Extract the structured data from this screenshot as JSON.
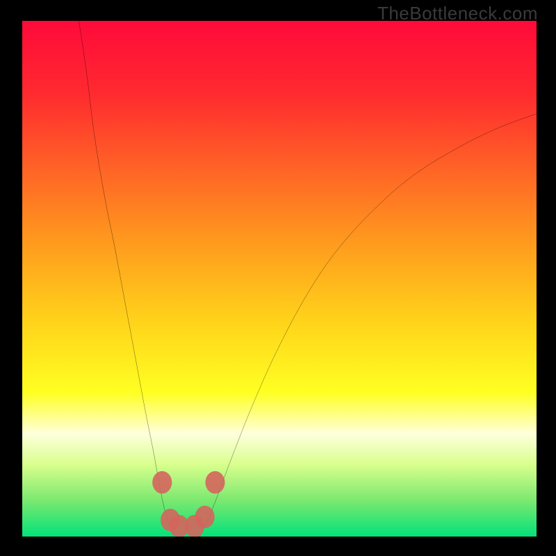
{
  "watermark": "TheBottleneck.com",
  "chart_data": {
    "type": "line",
    "title": "",
    "xlabel": "",
    "ylabel": "",
    "xlim": [
      0,
      100
    ],
    "ylim": [
      0,
      100
    ],
    "grid": false,
    "legend": false,
    "annotations": [],
    "gradient_stops": [
      {
        "pct": 0,
        "color": "#ff0a3a"
      },
      {
        "pct": 14,
        "color": "#ff2a2f"
      },
      {
        "pct": 40,
        "color": "#ff8f1f"
      },
      {
        "pct": 58,
        "color": "#ffd21a"
      },
      {
        "pct": 72,
        "color": "#ffff22"
      },
      {
        "pct": 78,
        "color": "#ffffaa"
      },
      {
        "pct": 80,
        "color": "#ffffdd"
      },
      {
        "pct": 86,
        "color": "#d9ff8d"
      },
      {
        "pct": 93,
        "color": "#7be86f"
      },
      {
        "pct": 100,
        "color": "#03e27a"
      }
    ],
    "series": [
      {
        "name": "left-branch",
        "points": [
          {
            "x": 11.0,
            "y": 100.0
          },
          {
            "x": 12.5,
            "y": 90.0
          },
          {
            "x": 14.0,
            "y": 78.0
          },
          {
            "x": 16.0,
            "y": 66.0
          },
          {
            "x": 18.0,
            "y": 56.0
          },
          {
            "x": 19.5,
            "y": 48.0
          },
          {
            "x": 21.0,
            "y": 40.0
          },
          {
            "x": 22.5,
            "y": 32.0
          },
          {
            "x": 24.0,
            "y": 24.0
          },
          {
            "x": 25.5,
            "y": 16.5
          },
          {
            "x": 26.5,
            "y": 11.0
          },
          {
            "x": 27.5,
            "y": 6.0
          },
          {
            "x": 28.5,
            "y": 2.5
          },
          {
            "x": 30.0,
            "y": 0.0
          }
        ]
      },
      {
        "name": "right-branch",
        "points": [
          {
            "x": 34.5,
            "y": 0.0
          },
          {
            "x": 36.0,
            "y": 3.0
          },
          {
            "x": 38.0,
            "y": 8.0
          },
          {
            "x": 41.0,
            "y": 16.0
          },
          {
            "x": 45.0,
            "y": 26.0
          },
          {
            "x": 50.0,
            "y": 37.0
          },
          {
            "x": 56.0,
            "y": 48.0
          },
          {
            "x": 62.0,
            "y": 56.5
          },
          {
            "x": 69.0,
            "y": 64.0
          },
          {
            "x": 76.0,
            "y": 70.0
          },
          {
            "x": 84.0,
            "y": 75.0
          },
          {
            "x": 92.0,
            "y": 79.0
          },
          {
            "x": 100.0,
            "y": 82.0
          }
        ]
      },
      {
        "name": "valley-floor",
        "points": [
          {
            "x": 30.0,
            "y": 0.0
          },
          {
            "x": 32.0,
            "y": -0.1
          },
          {
            "x": 34.5,
            "y": 0.0
          }
        ]
      }
    ],
    "markers": [
      {
        "x": 27.2,
        "y": 10.5
      },
      {
        "x": 28.8,
        "y": 3.2
      },
      {
        "x": 30.5,
        "y": 2.0
      },
      {
        "x": 33.5,
        "y": 2.0
      },
      {
        "x": 35.5,
        "y": 3.8
      },
      {
        "x": 37.5,
        "y": 10.5
      }
    ],
    "marker_style": {
      "r": 1.9,
      "fill": "#d4655d",
      "opacity": 0.9
    }
  }
}
